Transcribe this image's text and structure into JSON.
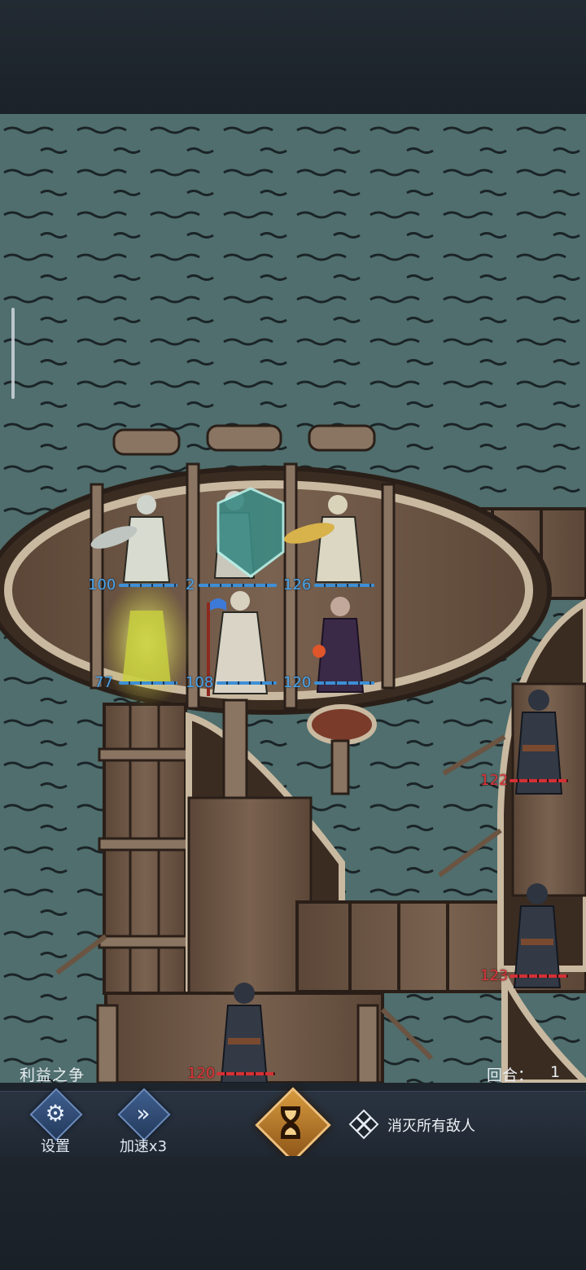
{
  "stage": {
    "name": "利益之争"
  },
  "round": {
    "label": "回合：",
    "value": "1"
  },
  "controls": {
    "settings_label": "设置",
    "speed_label": "加速x3",
    "settings_icon": "gear-icon",
    "speed_icon": "fast-forward-icon",
    "end_turn_icon": "hourglass-icon"
  },
  "objective": {
    "icon": "crossed-swords-icon",
    "text": "消灭所有敌人"
  },
  "allies": [
    {
      "hp": "100",
      "hp_fraction": 1.0
    },
    {
      "hp": "2",
      "hp_fraction": 1.0
    },
    {
      "hp": "126",
      "hp_fraction": 1.0
    },
    {
      "hp": "77",
      "hp_fraction": 1.0
    },
    {
      "hp": "108",
      "hp_fraction": 1.0
    },
    {
      "hp": "120",
      "hp_fraction": 1.0
    }
  ],
  "enemies": [
    {
      "hp": "122",
      "hp_fraction": 1.0
    },
    {
      "hp": "123",
      "hp_fraction": 1.0
    },
    {
      "hp": "120",
      "hp_fraction": 1.0
    }
  ],
  "colors": {
    "ally_hp": "#4aa3e8",
    "enemy_hp": "#d9363b",
    "water": "#50706f",
    "wood": "#6b5442",
    "hud_accent": "#d79a3e"
  }
}
